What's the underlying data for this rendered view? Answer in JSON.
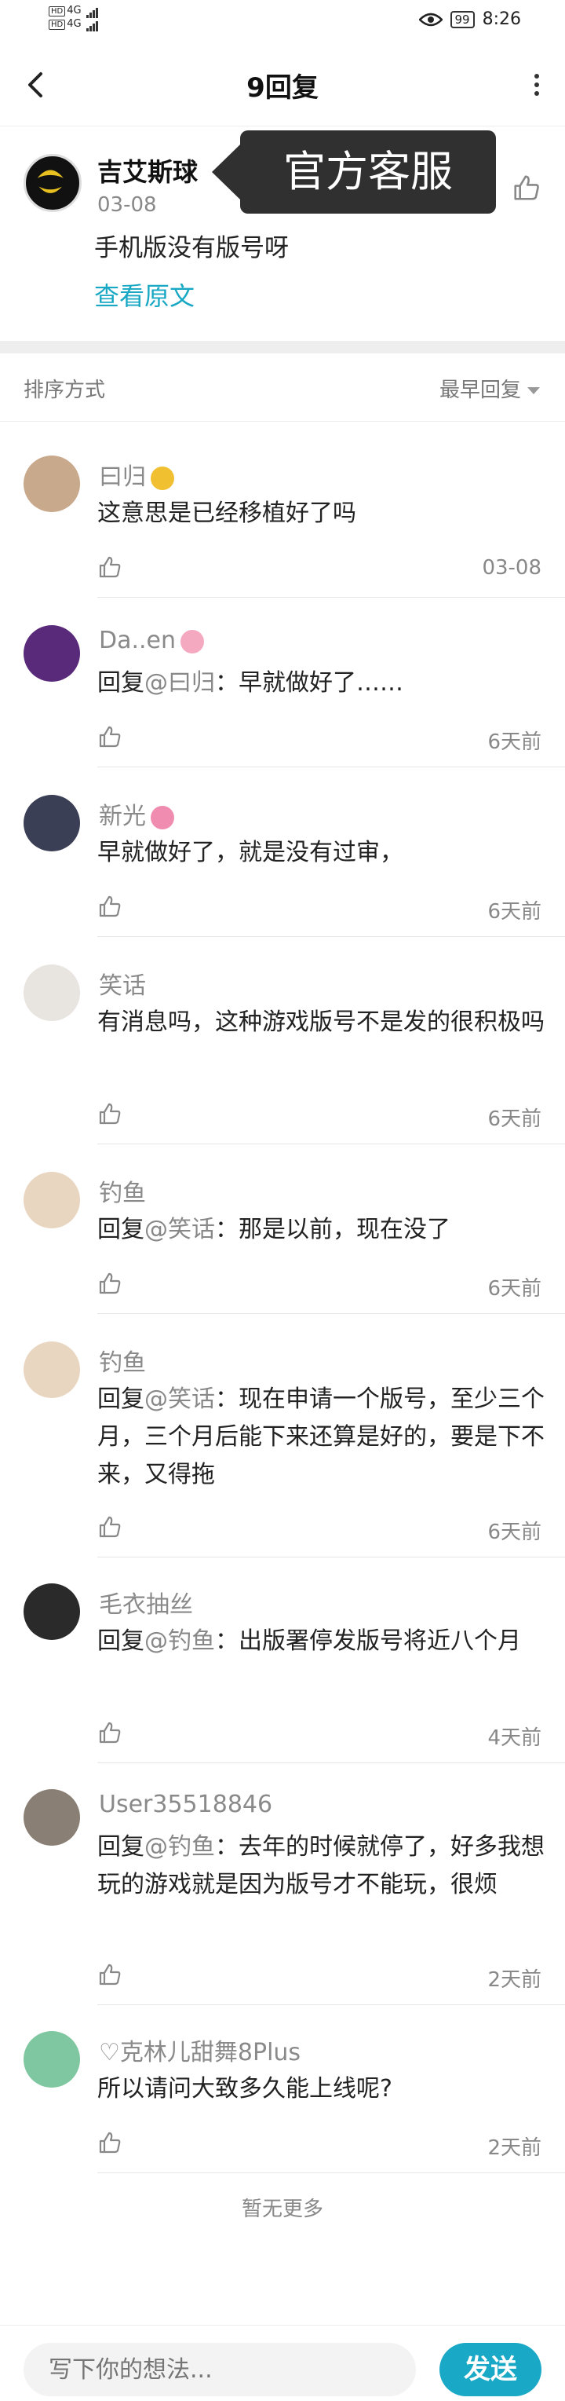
{
  "status_bar": {
    "hd1": "HD",
    "net1": "4G",
    "hd2": "HD",
    "net2": "4G",
    "battery": "99",
    "time": "8:26"
  },
  "header": {
    "title": "9回复"
  },
  "post": {
    "author": "吉艾斯球",
    "date": "03-08",
    "text": "手机版没有版号呀",
    "view_original": "查看原文",
    "official_label": "官方客服"
  },
  "sort": {
    "label": "排序方式",
    "value": "最早回复"
  },
  "replies": [
    {
      "name": "曰归",
      "text": "这意思是已经移植好了吗",
      "time": "03-08",
      "avatar_color": "#c9a98c",
      "badge_color": "#f0c030"
    },
    {
      "name": "Da..en",
      "reply_prefix": "回复",
      "at": "@曰归",
      "text": "：早就做好了……",
      "time": "6天前",
      "avatar_color": "#5a2a7a",
      "badge_color": "#f4a9c0"
    },
    {
      "name": "新光",
      "text": "早就做好了，就是没有过审，",
      "time": "6天前",
      "avatar_color": "#3b3f55",
      "badge_color": "#f08cb0"
    },
    {
      "name": "笑话",
      "text": "有消息吗，这种游戏版号不是发的很积极吗",
      "time": "6天前",
      "avatar_color": "#e8e4e0"
    },
    {
      "name": "钓鱼",
      "reply_prefix": "回复",
      "at": "@笑话",
      "text": "：那是以前，现在没了",
      "time": "6天前",
      "avatar_color": "#e9d6c0"
    },
    {
      "name": "钓鱼",
      "reply_prefix": "回复",
      "at": "@笑话",
      "text": "：现在申请一个版号，至少三个月，三个月后能下来还算是好的，要是下不来，又得拖",
      "time": "6天前",
      "avatar_color": "#e9d6c0"
    },
    {
      "name": "毛衣抽丝",
      "reply_prefix": "回复",
      "at": "@钓鱼",
      "text": "：出版署停发版号将近八个月",
      "time": "4天前",
      "avatar_color": "#2a2a2a"
    },
    {
      "name": "User35518846",
      "reply_prefix": "回复",
      "at": "@钓鱼",
      "text": "：去年的时候就停了，好多我想玩的游戏就是因为版号才不能玩，很烦",
      "time": "2天前",
      "avatar_color": "#8a7f74"
    },
    {
      "name": "♡克林儿甜舞8Plus",
      "text": "所以请问大致多久能上线呢?",
      "time": "2天前",
      "avatar_color": "#7fc7a0"
    }
  ],
  "no_more": "暂无更多",
  "composer": {
    "placeholder": "写下你的想法...",
    "send_label": "发送"
  },
  "colors": {
    "accent": "#19a9c6",
    "link": "#18a8c4",
    "official_bg": "#303030"
  }
}
